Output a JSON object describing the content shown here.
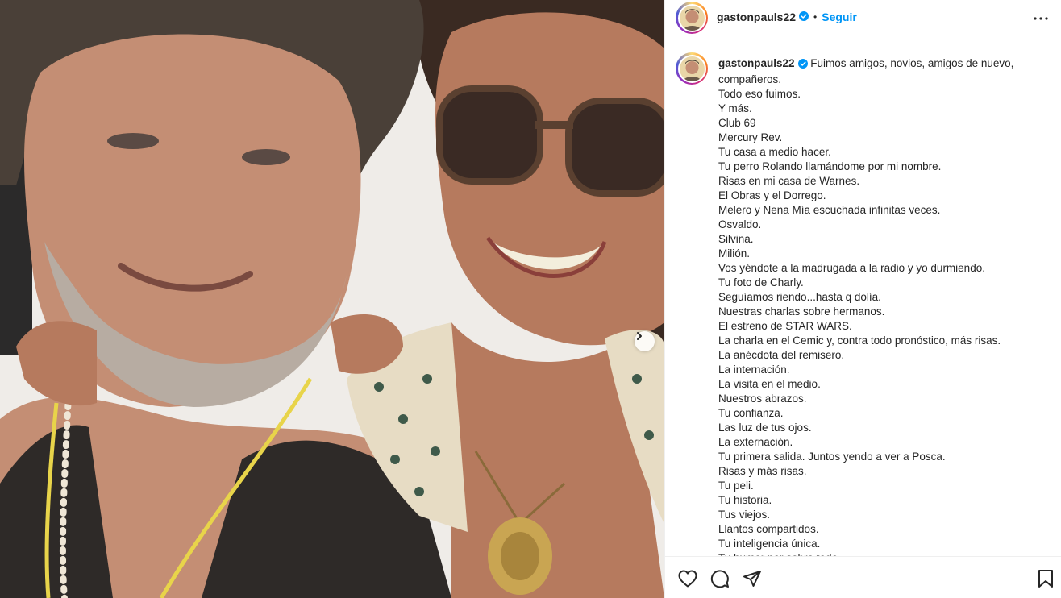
{
  "post": {
    "username": "gastonpauls22",
    "follow_label": "Seguir",
    "separator": "•",
    "caption_first": "Fuimos amigos, novios, amigos de nuevo,",
    "caption_lines": [
      "compañeros.",
      "Todo eso fuimos.",
      "Y más.",
      "Club 69",
      "Mercury Rev.",
      "Tu casa a medio hacer.",
      "Tu perro Rolando llamándome por mi nombre.",
      "Risas en mi casa de Warnes.",
      "El Obras y el Dorrego.",
      "Melero y Nena Mía escuchada infinitas veces.",
      "Osvaldo.",
      "Silvina.",
      "Milión.",
      "Vos yéndote a la madrugada a la radio y yo durmiendo.",
      "Tu foto de Charly.",
      "Seguíamos riendo...hasta q dolía.",
      "Nuestras charlas sobre hermanos.",
      "El estreno de STAR WARS.",
      "La charla en el Cemic y, contra todo pronóstico, más risas.",
      "La anécdota del remisero.",
      "La internación.",
      "La visita en el medio.",
      "Nuestros abrazos.",
      "Tu confianza.",
      "Las luz de tus ojos.",
      "La externación.",
      "Tu primera salida. Juntos yendo a ver a Posca.",
      "Risas y más risas.",
      "Tu peli.",
      "Tu historia.",
      "Tus viejos.",
      "Llantos compartidos.",
      "Tu inteligencia única.",
      "Tu humor por sobre todo."
    ]
  },
  "icons": {
    "verified": "verified-badge-icon",
    "more": "more-options-icon",
    "like": "heart-icon",
    "comment": "comment-icon",
    "share": "share-icon",
    "save": "bookmark-icon",
    "next": "chevron-right-icon"
  },
  "colors": {
    "accent": "#0095f6",
    "text": "#262626",
    "border": "#efefef"
  }
}
